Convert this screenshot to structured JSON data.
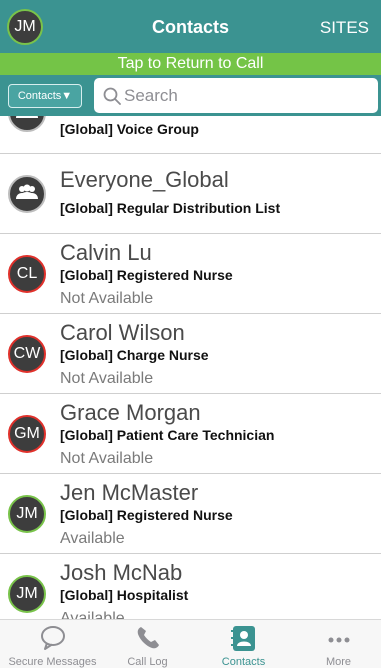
{
  "header": {
    "avatar_initials": "JM",
    "title": "Contacts",
    "sites_label": "SITES"
  },
  "banner": {
    "text": "Tap to Return to Call"
  },
  "search": {
    "filter_label": "Contacts▼",
    "placeholder": "Search",
    "value": ""
  },
  "contacts": [
    {
      "name": "",
      "role": "[Global] Voice Group",
      "status": "",
      "initials": "",
      "type": "group",
      "presence": "grey"
    },
    {
      "name": "Everyone_Global",
      "role": "[Global] Regular Distribution List",
      "status": "",
      "initials": "",
      "type": "group",
      "presence": "grey"
    },
    {
      "name": "Calvin Lu",
      "role": "[Global] Registered Nurse",
      "status": "Not Available",
      "initials": "CL",
      "type": "person",
      "presence": "red"
    },
    {
      "name": "Carol Wilson",
      "role": "[Global] Charge Nurse",
      "status": "Not Available",
      "initials": "CW",
      "type": "person",
      "presence": "red"
    },
    {
      "name": "Grace Morgan",
      "role": "[Global] Patient Care Technician",
      "status": "Not Available",
      "initials": "GM",
      "type": "person",
      "presence": "red"
    },
    {
      "name": "Jen McMaster",
      "role": "[Global] Registered Nurse",
      "status": "Available",
      "initials": "JM",
      "type": "person",
      "presence": "green"
    },
    {
      "name": "Josh McNab",
      "role": "[Global] Hospitalist",
      "status": "Available",
      "initials": "JM",
      "type": "person",
      "presence": "green"
    }
  ],
  "tabs": [
    {
      "label": "Secure Messages",
      "icon": "chat-bubble-icon",
      "active": false
    },
    {
      "label": "Call Log",
      "icon": "phone-icon",
      "active": false
    },
    {
      "label": "Contacts",
      "icon": "contacts-book-icon",
      "active": true
    },
    {
      "label": "More",
      "icon": "more-dots-icon",
      "active": false
    }
  ],
  "colors": {
    "header": "#3b9391",
    "banner": "#74c447",
    "presence_available": "#79c34a",
    "presence_unavailable": "#e0312b",
    "tab_active": "#3b9391",
    "tab_inactive": "#8e8e93"
  }
}
